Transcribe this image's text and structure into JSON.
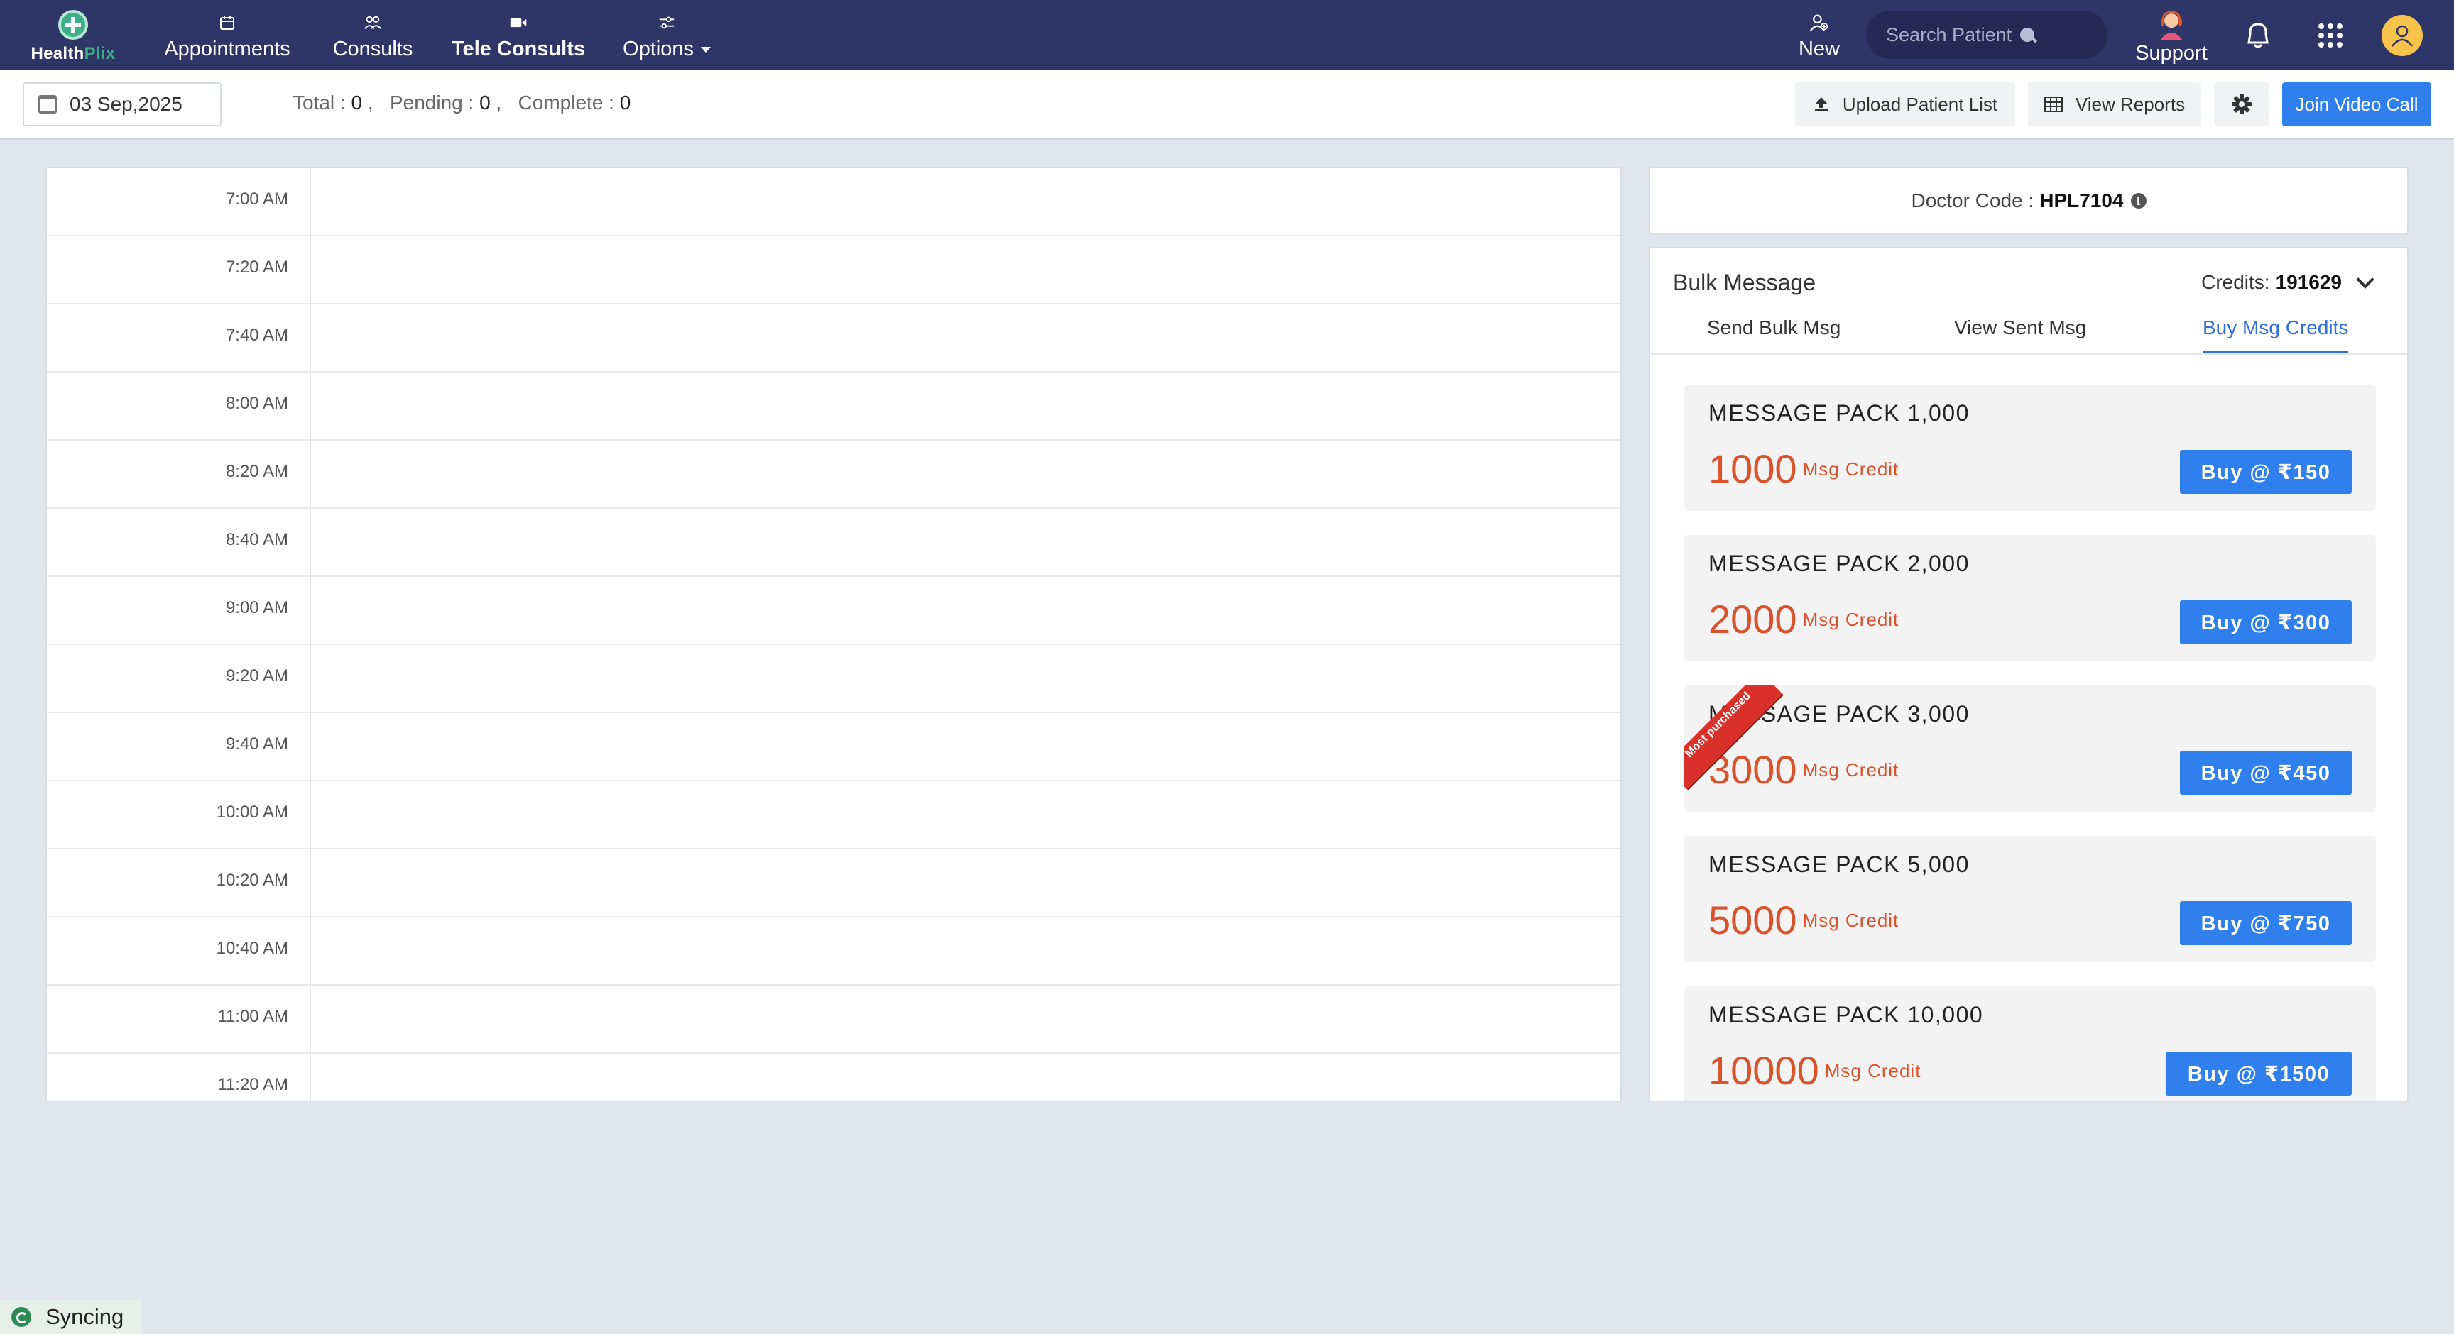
{
  "brand": {
    "name_part1": "Health",
    "name_part2": "Plix"
  },
  "nav": {
    "appointments": "Appointments",
    "consults": "Consults",
    "tele_consults": "Tele Consults",
    "options": "Options",
    "new": "New",
    "search_placeholder": "Search Patient",
    "support": "Support"
  },
  "subbar": {
    "date": "03 Sep,2025",
    "total_label": "Total : ",
    "total_value": "0",
    "pending_label": "Pending : ",
    "pending_value": "0",
    "complete_label": "Complete : ",
    "complete_value": "0",
    "upload_label": "Upload Patient List",
    "reports_label": "View Reports",
    "join_label": "Join Video Call"
  },
  "schedule": {
    "slots": [
      "7:00 AM",
      "7:20 AM",
      "7:40 AM",
      "8:00 AM",
      "8:20 AM",
      "8:40 AM",
      "9:00 AM",
      "9:20 AM",
      "9:40 AM",
      "10:00 AM",
      "10:20 AM",
      "10:40 AM",
      "11:00 AM",
      "11:20 AM"
    ]
  },
  "doctor": {
    "label": "Doctor Code : ",
    "code": "HPL7104"
  },
  "bulk": {
    "title": "Bulk Message",
    "credits_label": "Credits:",
    "credits_value": "191629",
    "tabs": [
      "Send Bulk Msg",
      "View Sent Msg",
      "Buy Msg Credits"
    ],
    "active_tab": "Buy Msg Credits",
    "unit_label": "Msg Credit",
    "ribbon_text": "Most purchased",
    "packs": [
      {
        "name": "MESSAGE PACK 1,000",
        "credits": "1000",
        "price": "Buy @ ₹150"
      },
      {
        "name": "MESSAGE PACK 2,000",
        "credits": "2000",
        "price": "Buy @ ₹300"
      },
      {
        "name": "MESSAGE PACK 3,000",
        "credits": "3000",
        "price": "Buy @ ₹450"
      },
      {
        "name": "MESSAGE PACK 5,000",
        "credits": "5000",
        "price": "Buy @ ₹750"
      },
      {
        "name": "MESSAGE PACK 10,000",
        "credits": "10000",
        "price": "Buy @ ₹1500"
      }
    ]
  },
  "status": {
    "syncing": "Syncing"
  },
  "colors": {
    "nav_bg": "#2e3567",
    "accent": "#2f80ed",
    "credit_orange": "#d9532c",
    "ribbon_red": "#d9302a",
    "brand_green": "#3fae88"
  }
}
